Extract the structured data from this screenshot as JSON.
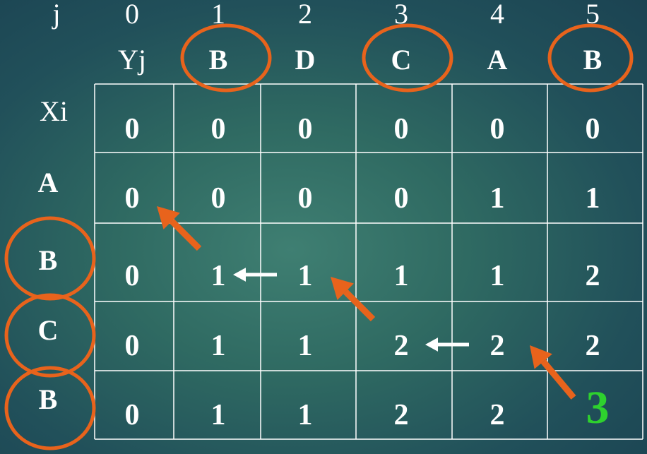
{
  "labels": {
    "j": "j",
    "yj": "Yj",
    "xi": "Xi"
  },
  "col_indices": [
    "0",
    "1",
    "2",
    "3",
    "4",
    "5"
  ],
  "y_sequence": [
    "B",
    "D",
    "C",
    "A",
    "B"
  ],
  "x_sequence": [
    "A",
    "B",
    "C",
    "B"
  ],
  "grid": [
    [
      "0",
      "0",
      "0",
      "0",
      "0",
      "0"
    ],
    [
      "0",
      "0",
      "0",
      "0",
      "1",
      "1"
    ],
    [
      "0",
      "1",
      "1",
      "1",
      "1",
      "2"
    ],
    [
      "0",
      "1",
      "1",
      "2",
      "2",
      "2"
    ],
    [
      "0",
      "1",
      "1",
      "2",
      "2",
      ""
    ]
  ],
  "result": "3",
  "colors": {
    "circle": "#e8631c",
    "arrow_orange": "#e8631c",
    "arrow_white": "#ffffff",
    "result": "#2ed12e",
    "grid_line": "#ffffff"
  }
}
